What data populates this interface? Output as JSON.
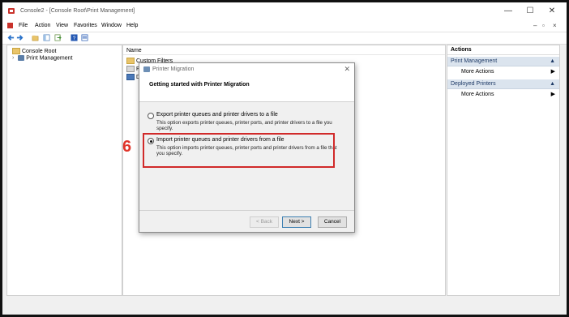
{
  "window": {
    "title": "Console2 - [Console Root\\Print Management]",
    "controls": [
      "—",
      "☐",
      "✕"
    ]
  },
  "menu": {
    "items": [
      "File",
      "Action",
      "View",
      "Favorites",
      "Window",
      "Help"
    ],
    "mdi_controls": [
      "–",
      "▫",
      "×"
    ]
  },
  "tree": {
    "root": "Console Root",
    "child": "Print Management",
    "expand_glyph": "›"
  },
  "content": {
    "column_header": "Name",
    "rows": [
      "Custom Filters",
      "Prir",
      "Dep"
    ]
  },
  "actions": {
    "header": "Actions",
    "sections": [
      {
        "title": "Print Management",
        "item": "More Actions"
      },
      {
        "title": "Deployed Printers",
        "item": "More Actions"
      }
    ],
    "caret": "▲",
    "arrow": "▶"
  },
  "dialog": {
    "title": "Printer Migration",
    "close": "✕",
    "heading": "Getting started with Printer Migration",
    "options": [
      {
        "label": "Export printer queues and printer drivers to a file",
        "description": "This option exports printer queues, printer ports, and printer drivers to a file you specify.",
        "selected": false
      },
      {
        "label": "Import printer queues and printer drivers from a file",
        "description": "This option imports printer queues, printer ports and printer drivers from a file that you specify.",
        "selected": true
      }
    ],
    "buttons": {
      "back": "< Back",
      "next": "Next >",
      "cancel": "Cancel"
    }
  },
  "annotation": {
    "step_number": "6",
    "color": "#d12a2a"
  }
}
